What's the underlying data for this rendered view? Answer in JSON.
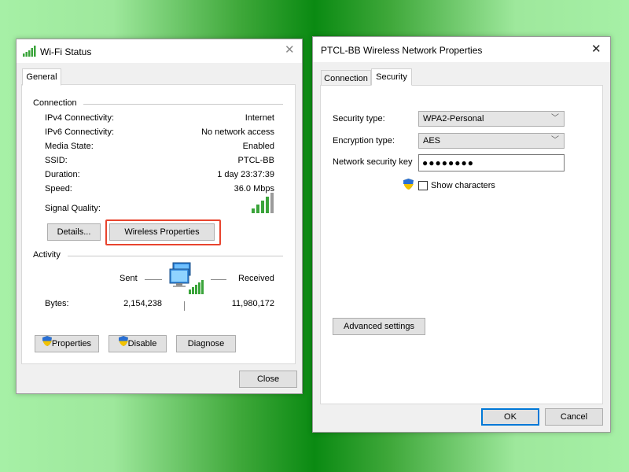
{
  "wifi_status": {
    "title": "Wi-Fi Status",
    "tab_general": "General",
    "connection_heading": "Connection",
    "rows": [
      {
        "label": "IPv4 Connectivity:",
        "value": "Internet"
      },
      {
        "label": "IPv6 Connectivity:",
        "value": "No network access"
      },
      {
        "label": "Media State:",
        "value": "Enabled"
      },
      {
        "label": "SSID:",
        "value": "PTCL-BB"
      },
      {
        "label": "Duration:",
        "value": "1 day 23:37:39"
      },
      {
        "label": "Speed:",
        "value": "36.0 Mbps"
      }
    ],
    "signal_quality_label": "Signal Quality:",
    "signal_bars_lit": 4,
    "signal_bars_total": 5,
    "details_button": "Details...",
    "wireless_properties_button": "Wireless Properties",
    "activity_heading": "Activity",
    "sent_label": "Sent",
    "received_label": "Received",
    "bytes_label": "Bytes:",
    "bytes_sent": "2,154,238",
    "bytes_received": "11,980,172",
    "properties_button": "Properties",
    "disable_button": "Disable",
    "diagnose_button": "Diagnose",
    "close_button": "Close"
  },
  "wireless_props": {
    "title": "PTCL-BB Wireless Network Properties",
    "tab_connection": "Connection",
    "tab_security": "Security",
    "security_type_label": "Security type:",
    "security_type_value": "WPA2-Personal",
    "encryption_type_label": "Encryption type:",
    "encryption_type_value": "AES",
    "network_key_label": "Network security key",
    "network_key_value": "●●●●●●●●",
    "show_characters_label": "Show characters",
    "advanced_settings_button": "Advanced settings",
    "ok_button": "OK",
    "cancel_button": "Cancel"
  },
  "colors": {
    "highlight": "#e8442e",
    "signal_green": "#3aa43a",
    "accent_blue": "#0078d7"
  },
  "icons": {
    "wifi": "wifi-signal-icon",
    "close": "close-icon",
    "shield": "uac-shield-icon",
    "network": "network-computer-icon",
    "dropdown": "chevron-down-icon"
  }
}
